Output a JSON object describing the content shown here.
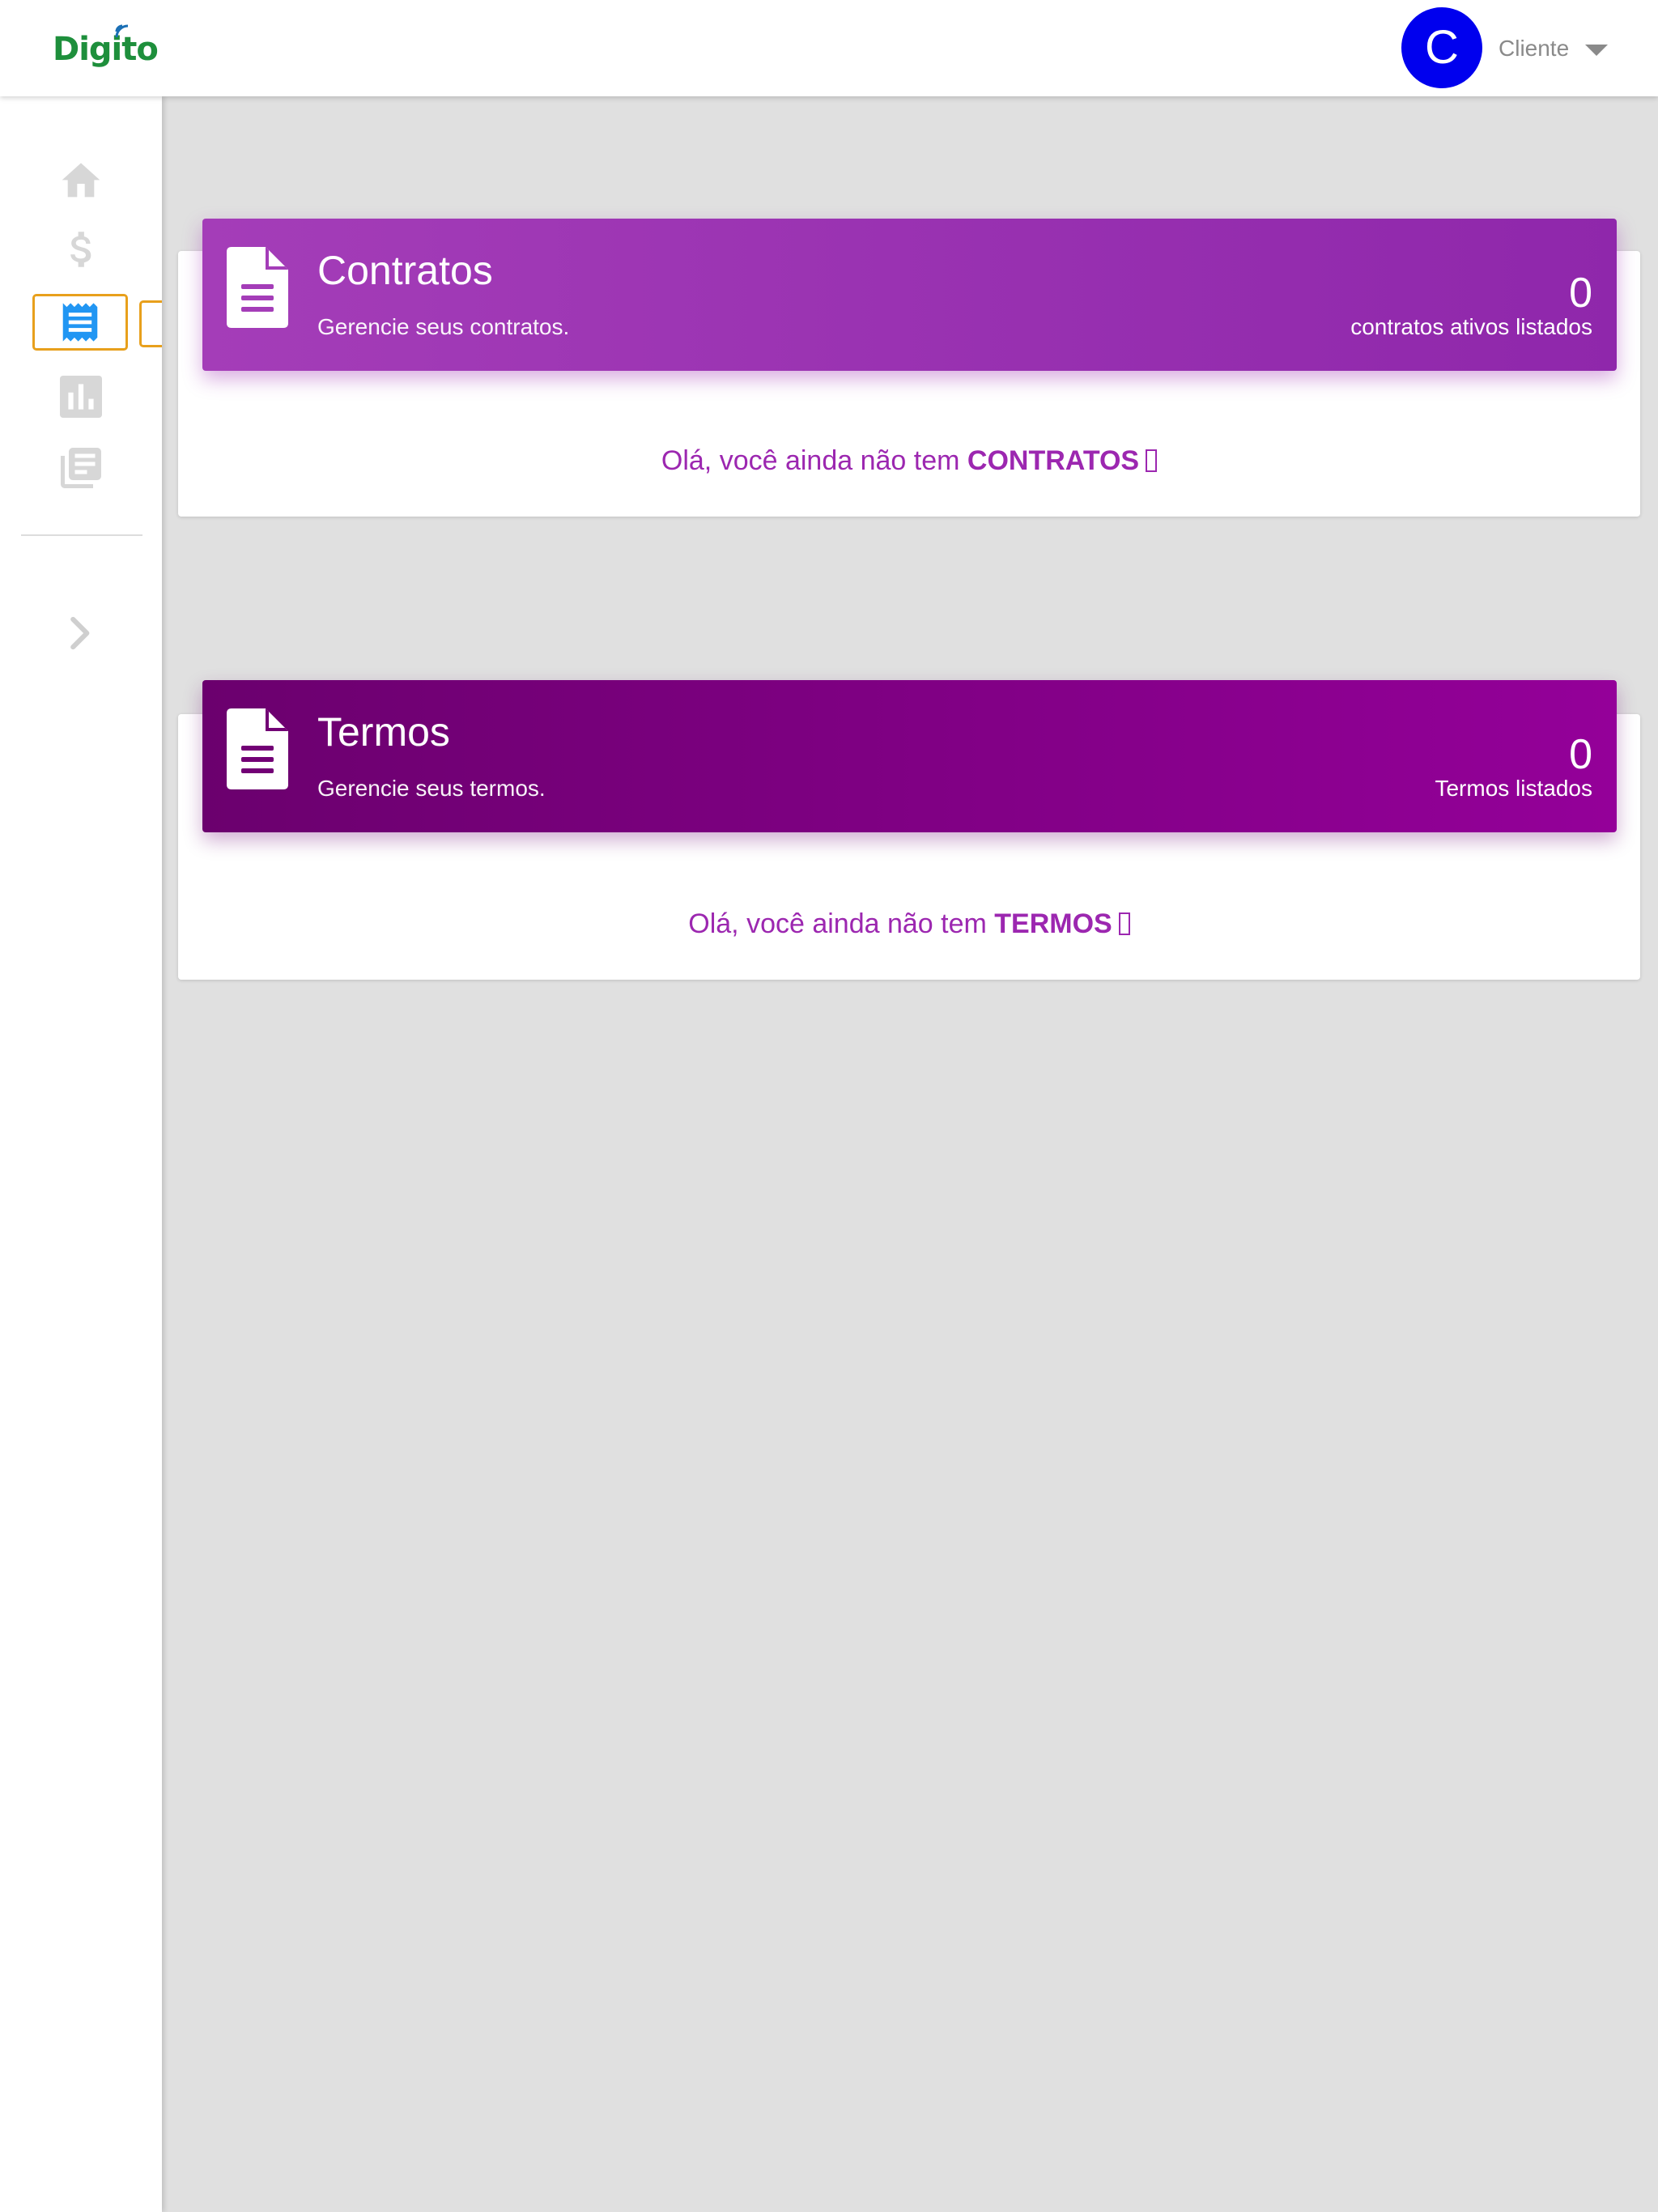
{
  "app": {
    "logo_text": "Digito"
  },
  "header": {
    "avatar_initial": "C",
    "user_role": "Cliente"
  },
  "sidebar": {
    "items": [
      {
        "icon": "home-icon"
      },
      {
        "icon": "dollar-icon"
      },
      {
        "icon": "receipt-icon",
        "active": true
      },
      {
        "icon": "bar-chart-icon"
      },
      {
        "icon": "library-books-icon"
      }
    ],
    "expand_icon": "chevron-right-icon"
  },
  "contratos": {
    "title": "Contratos",
    "subtitle": "Gerencie seus contratos.",
    "count": "0",
    "count_label": "contratos ativos listados",
    "empty_prefix": "Olá, você ainda não tem",
    "empty_strong": "CONTRATOS"
  },
  "termos": {
    "title": "Termos",
    "subtitle": "Gerencie seus termos.",
    "count": "0",
    "count_label": "Termos listados",
    "empty_prefix": "Olá, você ainda não tem",
    "empty_strong": "TERMOS"
  },
  "colors": {
    "accent": "#9c27b0",
    "contratos_header": "#a43db8",
    "termos_header": "#7a007e",
    "avatar": "#0000ee",
    "logo": "#1e8f3c",
    "active_nav": "#2196f3",
    "active_outline": "#e8a01c"
  }
}
